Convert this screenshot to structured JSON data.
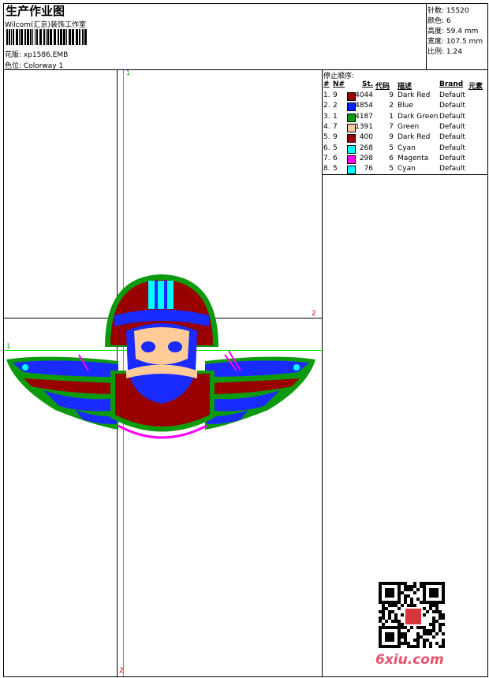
{
  "header": {
    "title": "生产作业图",
    "studio": "Wilcom(汇京)装饰工作室",
    "design_label": "花版:",
    "design_value": "xp1586.EMB",
    "colorway_label": "色位:",
    "colorway_value": "Colorway 1"
  },
  "info": [
    {
      "label": "针数:",
      "value": "15520"
    },
    {
      "label": "颜色:",
      "value": "6"
    },
    {
      "label": "高度:",
      "value": "59.4 mm"
    },
    {
      "label": "宽度:",
      "value": "107.5 mm"
    },
    {
      "label": "比例:",
      "value": "1.24"
    }
  ],
  "stop_sequence": {
    "title": "停止顺序:",
    "columns": [
      "#",
      "N#",
      "St.",
      "代码",
      "描述",
      "Brand",
      "元素"
    ],
    "rows": [
      {
        "idx": "1.",
        "n": "9",
        "color": "#990000",
        "st": "4044",
        "code": "9",
        "desc": "Dark Red",
        "brand": "Default"
      },
      {
        "idx": "2.",
        "n": "2",
        "color": "#0022ff",
        "st": "4854",
        "code": "2",
        "desc": "Blue",
        "brand": "Default"
      },
      {
        "idx": "3.",
        "n": "1",
        "color": "#0d9a0d",
        "st": "4187",
        "code": "1",
        "desc": "Dark Green",
        "brand": "Default"
      },
      {
        "idx": "4.",
        "n": "7",
        "color": "#ffcc99",
        "st": "1391",
        "code": "7",
        "desc": "Green",
        "brand": "Default"
      },
      {
        "idx": "5.",
        "n": "9",
        "color": "#990000",
        "st": "400",
        "code": "9",
        "desc": "Dark Red",
        "brand": "Default"
      },
      {
        "idx": "6.",
        "n": "5",
        "color": "#00ffff",
        "st": "268",
        "code": "5",
        "desc": "Cyan",
        "brand": "Default"
      },
      {
        "idx": "7.",
        "n": "6",
        "color": "#ff00ff",
        "st": "298",
        "code": "6",
        "desc": "Magenta",
        "brand": "Default"
      },
      {
        "idx": "8.",
        "n": "5",
        "color": "#00ffff",
        "st": "76",
        "code": "5",
        "desc": "Cyan",
        "brand": "Default"
      }
    ]
  },
  "guides": {
    "v1": "1",
    "h2": "2",
    "h1": "1",
    "v2": "2"
  },
  "watermark": "6xiu.com"
}
